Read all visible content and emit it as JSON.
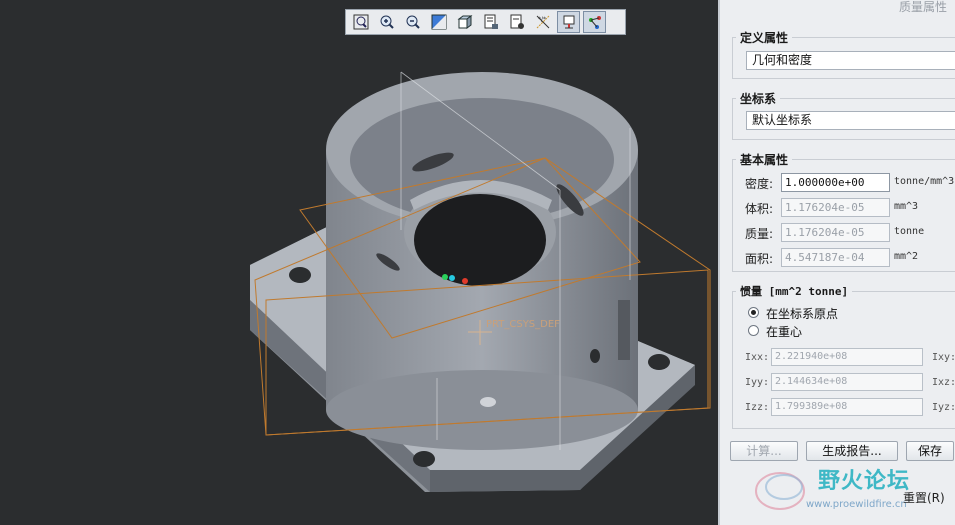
{
  "toolbar": {
    "icons": [
      "refit-icon",
      "zoom-in-icon",
      "zoom-out-icon",
      "repaint-icon",
      "display-style-icon",
      "saved-orientations-icon",
      "view-manager-icon",
      "datum-display-icon",
      "spin-center-icon",
      "csys-display-icon"
    ]
  },
  "viewport": {
    "csys_label": "PRT_CSYS_DEF",
    "colors": {
      "background": "#2b2d2f",
      "part": "#8c9199",
      "datum": "#c07a2e"
    }
  },
  "panel": {
    "title": "质量属性",
    "define": {
      "title": "定义属性",
      "value": "几何和密度"
    },
    "csys": {
      "title": "坐标系",
      "value": "默认坐标系"
    },
    "basic": {
      "title": "基本属性",
      "density": {
        "label": "密度:",
        "value": "1.000000e+00",
        "unit": "tonne/mm^3"
      },
      "volume": {
        "label": "体积:",
        "value": "1.176204e-05",
        "unit": "mm^3"
      },
      "mass": {
        "label": "质量:",
        "value": "1.176204e-05",
        "unit": "tonne"
      },
      "area": {
        "label": "面积:",
        "value": "4.547187e-04",
        "unit": "mm^2"
      }
    },
    "inertia": {
      "title": "惯量 [mm^2 tonne]",
      "option_origin": "在坐标系原点",
      "option_center": "在重心",
      "ixx": {
        "label": "Ixx:",
        "value": "2.221940e+08"
      },
      "iyy": {
        "label": "Iyy:",
        "value": "2.144634e+08"
      },
      "izz": {
        "label": "Izz:",
        "value": "1.799389e+08"
      },
      "ixy_label": "Ixy:",
      "ixz_label": "Ixz:",
      "iyz_label": "Iyz:"
    },
    "buttons": {
      "calculate": "计算...",
      "report": "生成报告...",
      "save": "保存",
      "reset": "重置(R)"
    }
  },
  "watermark": {
    "text": "野火论坛",
    "url": "www.proewildfire.cn"
  }
}
